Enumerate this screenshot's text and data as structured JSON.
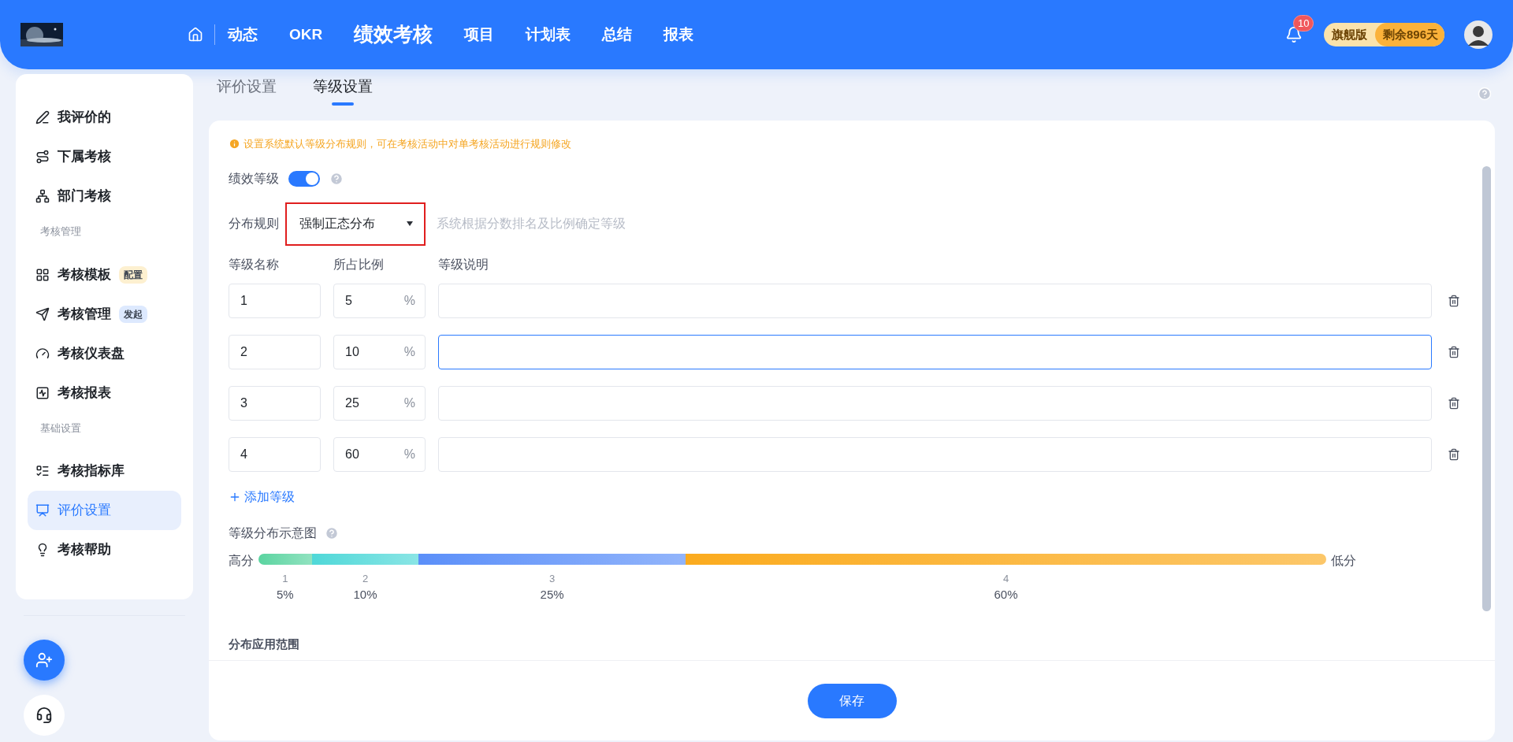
{
  "header": {
    "nav": [
      {
        "label": "动态",
        "selected": false
      },
      {
        "label": "OKR",
        "selected": false
      },
      {
        "label": "绩效考核",
        "selected": true
      },
      {
        "label": "项目",
        "selected": false
      },
      {
        "label": "计划表",
        "selected": false
      },
      {
        "label": "总结",
        "selected": false
      },
      {
        "label": "报表",
        "selected": false
      }
    ],
    "notification_count": "10",
    "plan": {
      "edition": "旗舰版",
      "remaining": "剩余896天"
    }
  },
  "sidebar": {
    "groups": [
      {
        "items": [
          {
            "label": "我评价的",
            "selected": false
          },
          {
            "label": "下属考核",
            "selected": false
          },
          {
            "label": "部门考核",
            "selected": false
          }
        ]
      },
      {
        "title": "考核管理",
        "items": [
          {
            "label": "考核模板",
            "selected": false,
            "badge": {
              "text": "配置",
              "color": "#fdf0d0"
            }
          },
          {
            "label": "考核管理",
            "selected": false,
            "badge": {
              "text": "发起",
              "color": "#dde9fe"
            }
          },
          {
            "label": "考核仪表盘",
            "selected": false
          },
          {
            "label": "考核报表",
            "selected": false
          }
        ]
      },
      {
        "title": "基础设置",
        "items": [
          {
            "label": "考核指标库",
            "selected": false
          },
          {
            "label": "评价设置",
            "selected": true
          },
          {
            "label": "考核帮助",
            "selected": false
          }
        ]
      }
    ]
  },
  "tabs": [
    {
      "label": "评价设置",
      "selected": false
    },
    {
      "label": "等级设置",
      "selected": true
    }
  ],
  "notice": "设置系统默认等级分布规则，可在考核活动中对单考核活动进行规则修改",
  "performance_level": {
    "label": "绩效等级",
    "on": true
  },
  "distribution_rule": {
    "label": "分布规则",
    "value": "强制正态分布",
    "hint": "系统根据分数排名及比例确定等级",
    "highlighted": true
  },
  "levels": {
    "columns": [
      "等级名称",
      "所占比例",
      "等级说明"
    ],
    "rows": [
      {
        "name": "1",
        "ratio": "5",
        "unit": "%",
        "focused": false
      },
      {
        "name": "2",
        "ratio": "10",
        "unit": "%",
        "focused": true
      },
      {
        "name": "3",
        "ratio": "25",
        "unit": "%",
        "focused": false
      },
      {
        "name": "4",
        "ratio": "60",
        "unit": "%",
        "focused": false
      }
    ]
  },
  "add_level": "添加等级",
  "diagram": {
    "title": "等级分布示意图",
    "high_label": "高分",
    "low_label": "低分",
    "segments": [
      {
        "label": "1",
        "percent": "5%",
        "level": 0.05,
        "color": "#5ad4a0"
      },
      {
        "label": "2",
        "percent": "10%",
        "level": 0.1,
        "color": "#4fd8d8"
      },
      {
        "label": "3",
        "percent": "25%",
        "level": 0.25,
        "color": "#5b8ff9"
      },
      {
        "label": "4",
        "percent": "60%",
        "level": 0.6,
        "color": "#fbab1e"
      }
    ]
  },
  "section_title": "分布应用范围",
  "save": "保存"
}
